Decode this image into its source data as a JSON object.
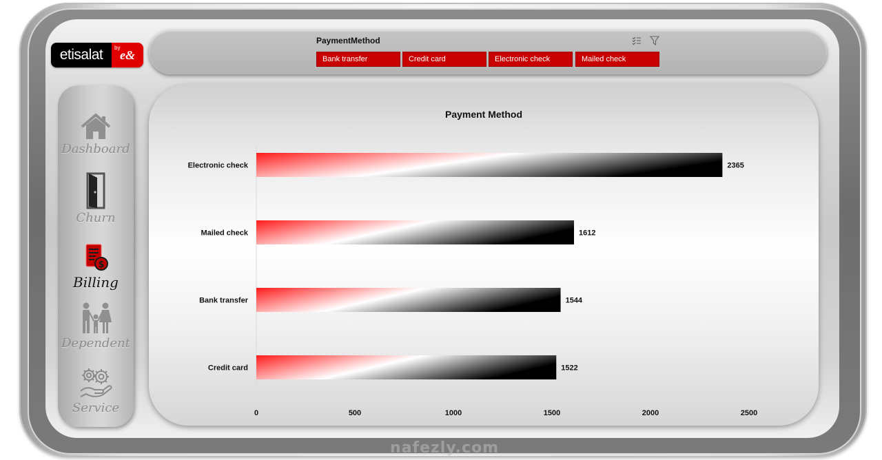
{
  "brand": {
    "name": "etisalat",
    "badge_by": "by",
    "badge_mark": "e&"
  },
  "slicer": {
    "title": "PaymentMethod",
    "options": [
      "Bank transfer",
      "Credit card",
      "Electronic check",
      "Mailed check"
    ],
    "icons": [
      "multi-select-icon",
      "clear-filter-icon"
    ],
    "selected_color": "#c80000"
  },
  "nav": [
    {
      "label": "Dashboard",
      "icon": "home-icon",
      "active": false
    },
    {
      "label": "Churn",
      "icon": "door-icon",
      "active": false
    },
    {
      "label": "Billing",
      "icon": "billing-icon",
      "active": true
    },
    {
      "label": "Dependent",
      "icon": "family-icon",
      "active": false
    },
    {
      "label": "Service",
      "icon": "service-gears-icon",
      "active": false
    }
  ],
  "chart_data": {
    "type": "bar",
    "orientation": "horizontal",
    "title": "Payment Method",
    "categories": [
      "Electronic check",
      "Mailed check",
      "Bank transfer",
      "Credit card"
    ],
    "values": [
      2365,
      1612,
      1544,
      1522
    ],
    "xlim": [
      0,
      2500
    ],
    "xticks": [
      0,
      500,
      1000,
      1500,
      2000,
      2500
    ],
    "grid": false,
    "bar_gradient": [
      "#ff1a1a",
      "#ffffff",
      "#000000"
    ]
  },
  "watermark": "nafezly.com"
}
